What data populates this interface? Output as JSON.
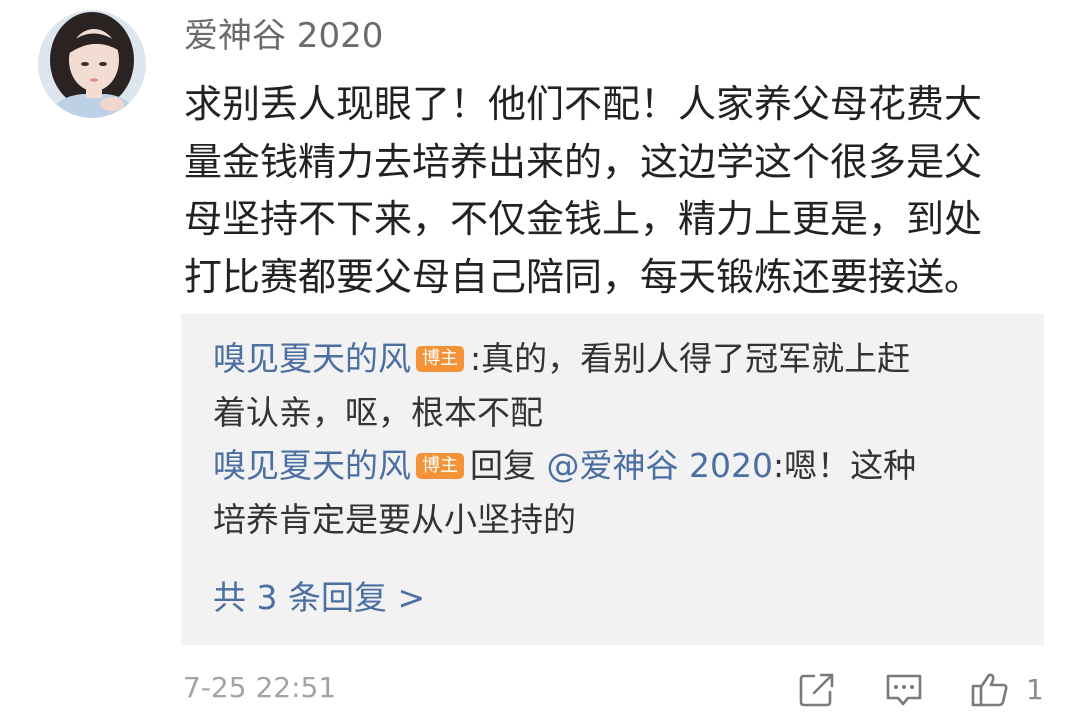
{
  "comment": {
    "username": "爱神谷 2020",
    "content_lines": [
      "求别丢人现眼了！他们不配！人家养父母花费大",
      "量金钱精力去培养出来的，这边学这个很多是父",
      "母坚持不下来，不仅金钱上，精力上更是，到处",
      "打比赛都要父母自己陪同，每天锻炼还要接送。"
    ],
    "timestamp": "7-25 22:51",
    "like_count": "1"
  },
  "replies": [
    {
      "author": "嗅见夏天的风",
      "badge": "博主",
      "line1_text": ":真的，看别人得了冠军就上赶",
      "line2_text": "着认亲，呕，根本不配"
    },
    {
      "author": "嗅见夏天的风",
      "badge": "博主",
      "reply_word": "回复",
      "mention": "@爱神谷 2020",
      "line1_text": ":嗯！这种",
      "line2_text": "培养肯定是要从小坚持的"
    }
  ],
  "more_replies": "共 3 条回复 >",
  "icons": {
    "forward": "forward-icon",
    "comment": "comment-icon",
    "like": "thumbs-up-icon"
  },
  "colors": {
    "link_blue": "#4b6fa0",
    "badge_orange": "#f39237",
    "reply_background": "#f2f2f2",
    "meta_gray": "#a3a3a3"
  }
}
